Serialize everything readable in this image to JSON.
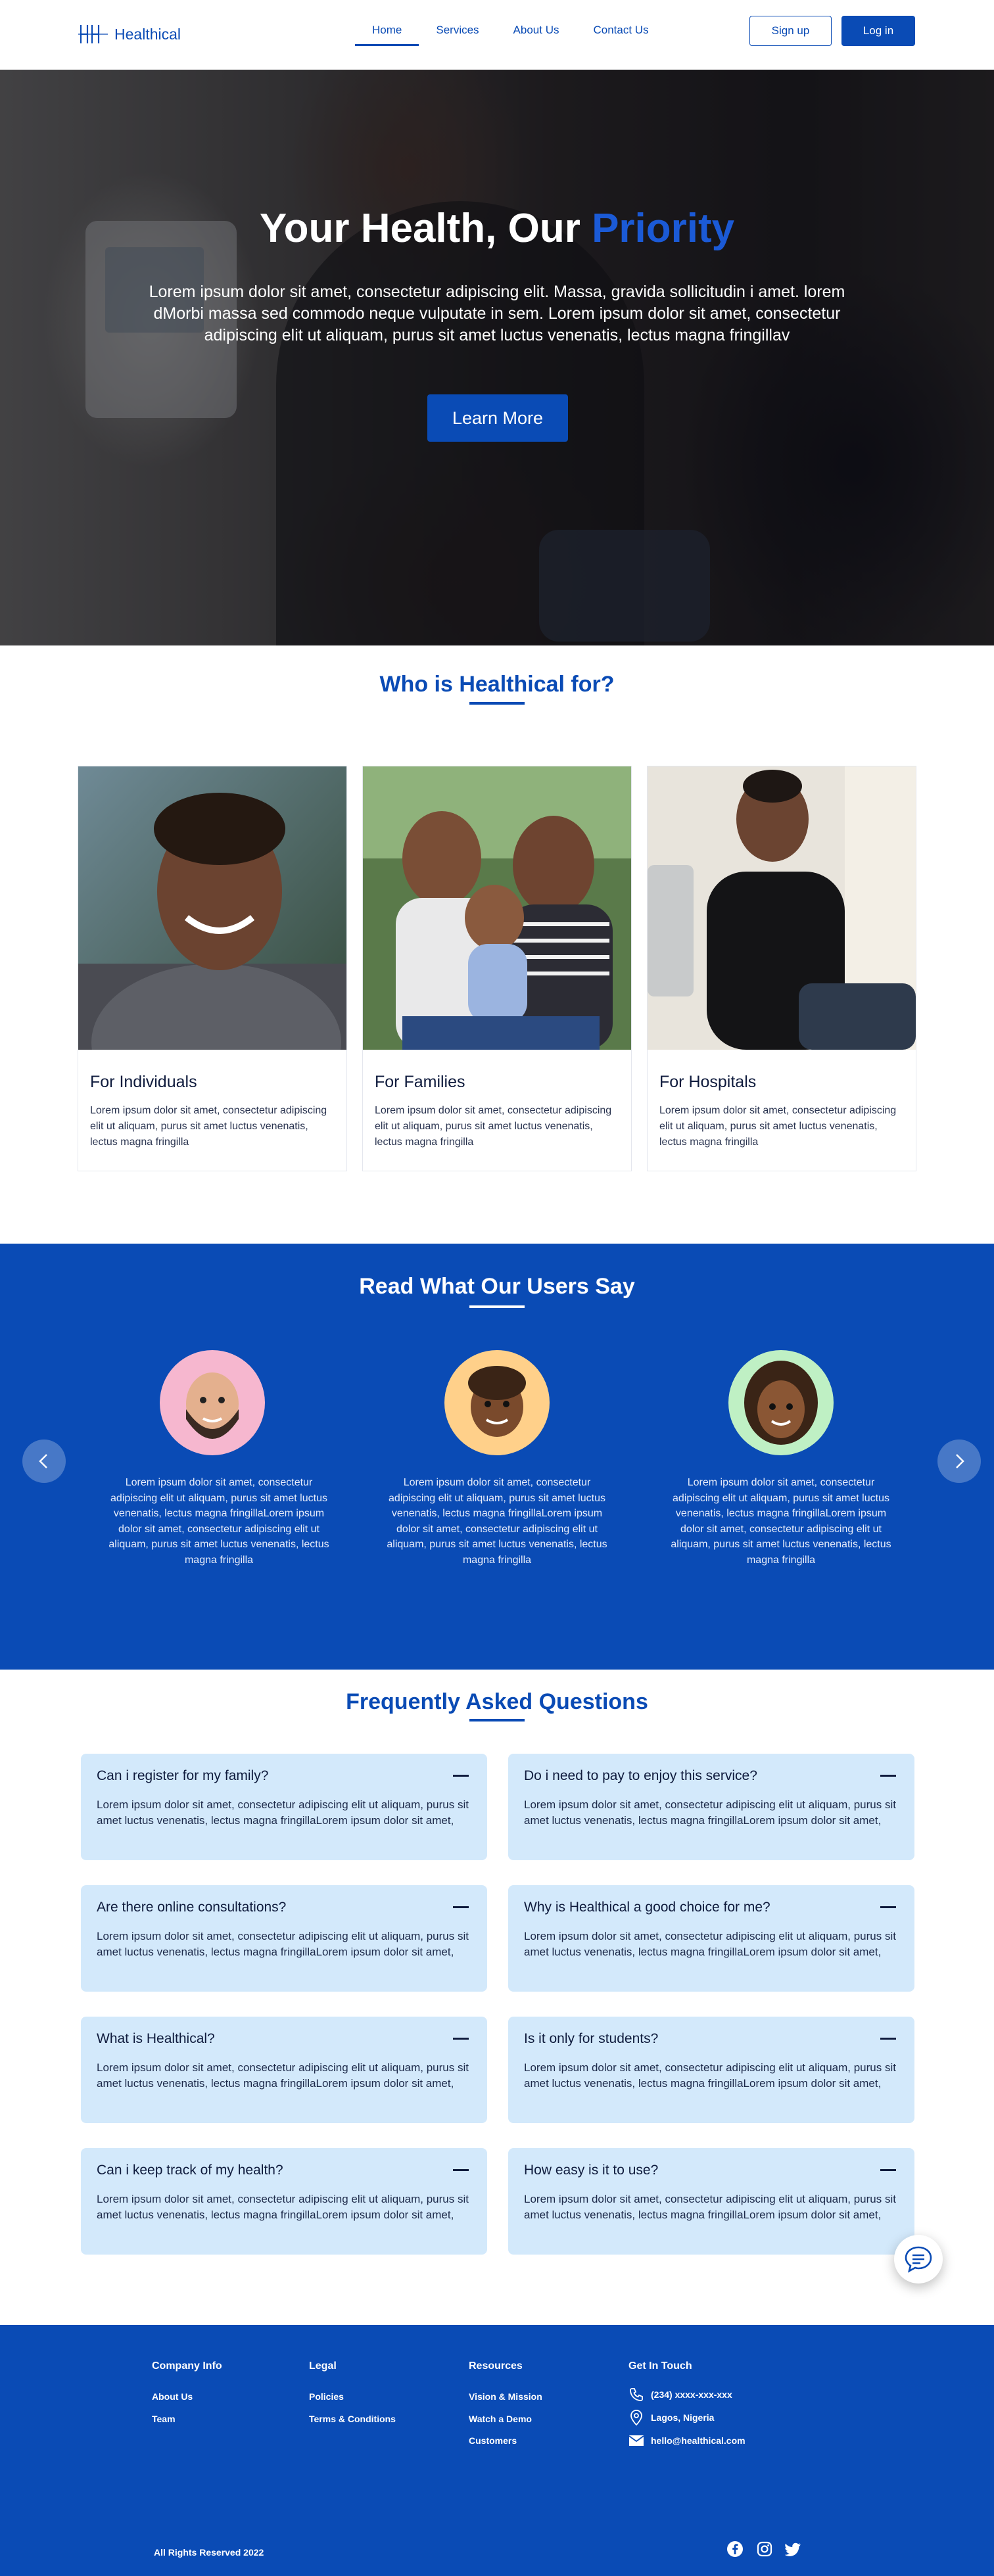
{
  "brand": {
    "name": "Healthical",
    "primary": "#0a4bb5",
    "light": "#d3e9fb"
  },
  "nav": {
    "items": [
      "Home",
      "Services",
      "About Us",
      "Contact Us"
    ],
    "active": "Home",
    "signup": "Sign up",
    "login": "Log in"
  },
  "hero": {
    "title_main": "Your Health, Our ",
    "title_accent": "Priority",
    "text": "Lorem ipsum dolor sit amet, consectetur adipiscing elit. Massa, gravida sollicitudin i amet. lorem dMorbi massa sed commodo neque vulputate in sem. Lorem ipsum dolor sit amet, consectetur adipiscing elit ut aliquam, purus sit amet luctus venenatis, lectus magna fringillav",
    "cta": "Learn More"
  },
  "who": {
    "title": "Who is Healthical for?",
    "cards": [
      {
        "title": "For Individuals",
        "text": "Lorem ipsum dolor sit amet, consectetur adipiscing elit ut aliquam, purus sit amet luctus venenatis, lectus magna fringilla"
      },
      {
        "title": "For Families",
        "text": "Lorem ipsum dolor sit amet, consectetur adipiscing elit ut aliquam, purus sit amet luctus venenatis, lectus magna fringilla"
      },
      {
        "title": "For Hospitals",
        "text": "Lorem ipsum dolor sit amet, consectetur adipiscing elit ut aliquam, purus sit amet luctus venenatis, lectus magna fringilla"
      }
    ]
  },
  "testimonials": {
    "title": "Read What Our Users Say",
    "items": [
      {
        "text": "Lorem ipsum dolor sit amet, consectetur adipiscing elit ut aliquam, purus sit amet luctus venenatis, lectus magna fringillaLorem ipsum dolor sit amet, consectetur adipiscing elit ut aliquam, purus sit amet luctus venenatis, lectus magna fringilla",
        "bg": "#f6b7cf"
      },
      {
        "text": "Lorem ipsum dolor sit amet, consectetur adipiscing elit ut aliquam, purus sit amet luctus venenatis, lectus magna fringillaLorem ipsum dolor sit amet, consectetur adipiscing elit ut aliquam, purus sit amet luctus venenatis, lectus magna fringilla",
        "bg": "#ffd08a"
      },
      {
        "text": "Lorem ipsum dolor sit amet, consectetur adipiscing elit ut aliquam, purus sit amet luctus venenatis, lectus magna fringillaLorem ipsum dolor sit amet, consectetur adipiscing elit ut aliquam, purus sit amet luctus venenatis, lectus magna fringilla",
        "bg": "#bff0c4"
      }
    ]
  },
  "faq": {
    "title": "Frequently Asked Questions",
    "items": [
      {
        "q": "Can i register for my family?",
        "a": "Lorem ipsum dolor sit amet, consectetur adipiscing elit ut aliquam, purus sit amet luctus venenatis, lectus magna fringillaLorem ipsum dolor sit amet,"
      },
      {
        "q": "Do i need to pay to enjoy this service?",
        "a": "Lorem ipsum dolor sit amet, consectetur adipiscing elit ut aliquam, purus sit amet luctus venenatis, lectus magna fringillaLorem ipsum dolor sit amet,"
      },
      {
        "q": "Are there online consultations?",
        "a": "Lorem ipsum dolor sit amet, consectetur adipiscing elit ut aliquam, purus sit amet luctus venenatis, lectus magna fringillaLorem ipsum dolor sit amet,"
      },
      {
        "q": "Why is Healthical a good choice for me?",
        "a": "Lorem ipsum dolor sit amet, consectetur adipiscing elit ut aliquam, purus sit amet luctus venenatis, lectus magna fringillaLorem ipsum dolor sit amet,"
      },
      {
        "q": "What is Healthical?",
        "a": "Lorem ipsum dolor sit amet, consectetur adipiscing elit ut aliquam, purus sit amet luctus venenatis, lectus magna fringillaLorem ipsum dolor sit amet,"
      },
      {
        "q": "Is it only for students?",
        "a": "Lorem ipsum dolor sit amet, consectetur adipiscing elit ut aliquam, purus sit amet luctus venenatis, lectus magna fringillaLorem ipsum dolor sit amet,"
      },
      {
        "q": "Can i keep track of my health?",
        "a": "Lorem ipsum dolor sit amet, consectetur adipiscing elit ut aliquam, purus sit amet luctus venenatis, lectus magna fringillaLorem ipsum dolor sit amet,"
      },
      {
        "q": "How easy is it to use?",
        "a": "Lorem ipsum dolor sit amet, consectetur adipiscing elit ut aliquam, purus sit amet luctus venenatis, lectus magna fringillaLorem ipsum dolor sit amet,"
      }
    ]
  },
  "footer": {
    "company": {
      "title": "Company Info",
      "links": [
        "About Us",
        "Team"
      ]
    },
    "legal": {
      "title": "Legal",
      "links": [
        "Policies",
        "Terms & Conditions"
      ]
    },
    "resources": {
      "title": "Resources",
      "links": [
        "Vision & Mission",
        "Watch a Demo",
        "Customers"
      ]
    },
    "contact": {
      "title": "Get In Touch",
      "phone": "(234) xxxx-xxx-xxx",
      "location": "Lagos, Nigeria",
      "email": "hello@healthical.com"
    },
    "copyright": "All Rights Reserved 2022",
    "social": [
      "facebook-icon",
      "instagram-icon",
      "twitter-icon"
    ]
  }
}
